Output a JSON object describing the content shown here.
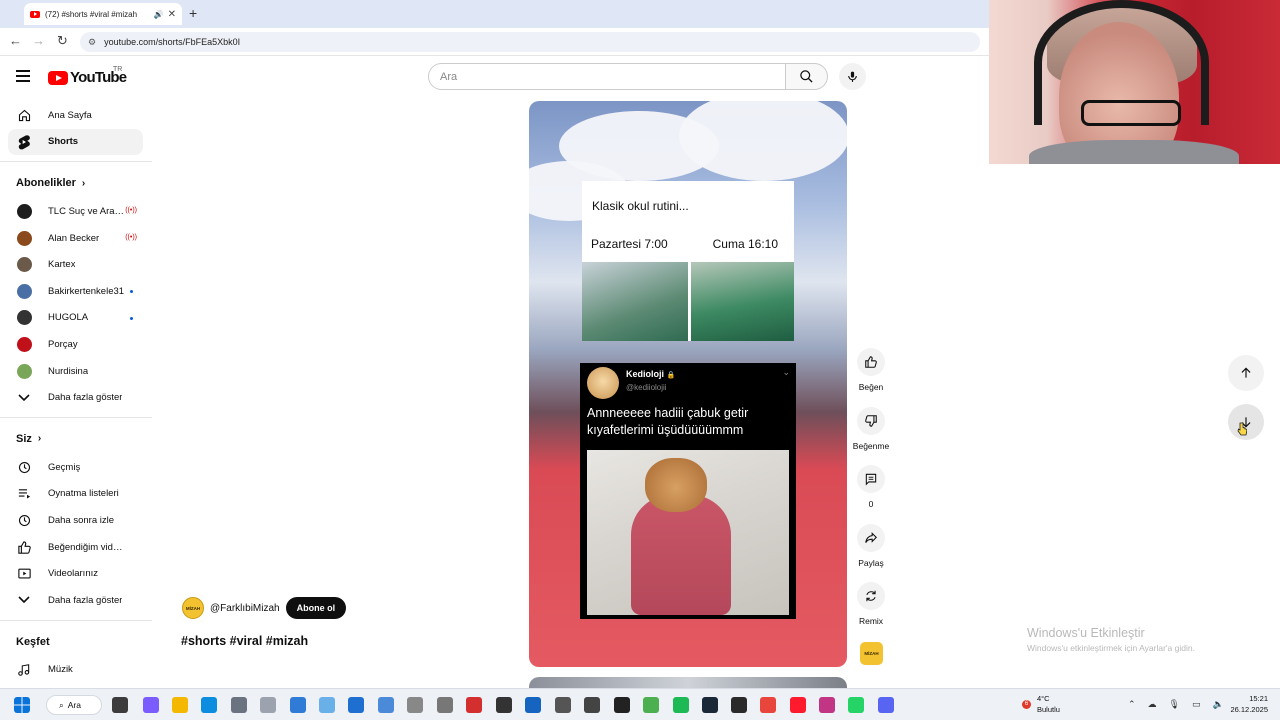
{
  "browser": {
    "tab_title": "(72) #shorts #viral #mizah",
    "new_tab": "+",
    "url": "youtube.com/shorts/FbFEa5Xbk0I"
  },
  "masthead": {
    "logo_text": "YouTube",
    "region": "TR",
    "search_placeholder": "Ara"
  },
  "sidebar": {
    "main": [
      {
        "label": "Ana Sayfa",
        "icon": "home-icon"
      },
      {
        "label": "Shorts",
        "icon": "shorts-icon",
        "active": true
      }
    ],
    "subscriptions_title": "Abonelikler",
    "subscriptions": [
      {
        "label": "TLC Suç ve Araştırma",
        "live": true,
        "color": "#1d1d1d"
      },
      {
        "label": "Alan Becker",
        "live": true,
        "color": "#8a4a1c"
      },
      {
        "label": "Kartex",
        "live": false,
        "color": "#6b5a4a"
      },
      {
        "label": "Bakirkertenkele31",
        "new": true,
        "color": "#4a6fa5"
      },
      {
        "label": "HUGOLA",
        "new": true,
        "color": "#333333"
      },
      {
        "label": "Porçay",
        "live": false,
        "color": "#c0101a"
      },
      {
        "label": "Nurdisina",
        "live": false,
        "color": "#7aa65a"
      }
    ],
    "show_more_1": "Daha fazla göster",
    "you_title": "Siz",
    "you_items": [
      {
        "label": "Geçmiş",
        "icon": "history-icon"
      },
      {
        "label": "Oynatma listeleri",
        "icon": "playlists-icon"
      },
      {
        "label": "Daha sonra izle",
        "icon": "watch-later-icon"
      },
      {
        "label": "Beğendiğim videolar",
        "icon": "liked-icon"
      },
      {
        "label": "Videolarınız",
        "icon": "your-videos-icon"
      }
    ],
    "show_more_2": "Daha fazla göster",
    "explore_title": "Keşfet",
    "explore_items": [
      {
        "label": "Müzik",
        "icon": "music-icon"
      }
    ]
  },
  "short": {
    "card_title": "Klasik okul rutini...",
    "card_left": "Pazartesi 7:00",
    "card_right": "Cuma 16:10",
    "tweet_name": "Kedioloji",
    "tweet_handle": "@kediiolojii",
    "tweet_text": "Annneeeee hadiii çabuk getir kıyafetlerimi üşüdüüüümmm",
    "channel": "@FarklıbiMizah",
    "channel_avatar_text": "MİZAH",
    "subscribe": "Abone ol",
    "hashtags": "#shorts #viral #mizah"
  },
  "actions": [
    {
      "label": "Beğen",
      "icon": "like-icon"
    },
    {
      "label": "Beğenme",
      "icon": "dislike-icon"
    },
    {
      "label": "0",
      "icon": "comment-icon"
    },
    {
      "label": "Paylaş",
      "icon": "share-icon"
    },
    {
      "label": "Remix",
      "icon": "remix-icon"
    }
  ],
  "watermark": {
    "line1": "Windows'u Etkinleştir",
    "line2": "Windows'u etkinleştirmek için Ayarlar'a gidin."
  },
  "taskbar": {
    "search": "Ara",
    "weather_badge": "6",
    "temp": "4°C",
    "condition": "Bulutlu",
    "time": "15:21",
    "date": "26.12.2025"
  }
}
